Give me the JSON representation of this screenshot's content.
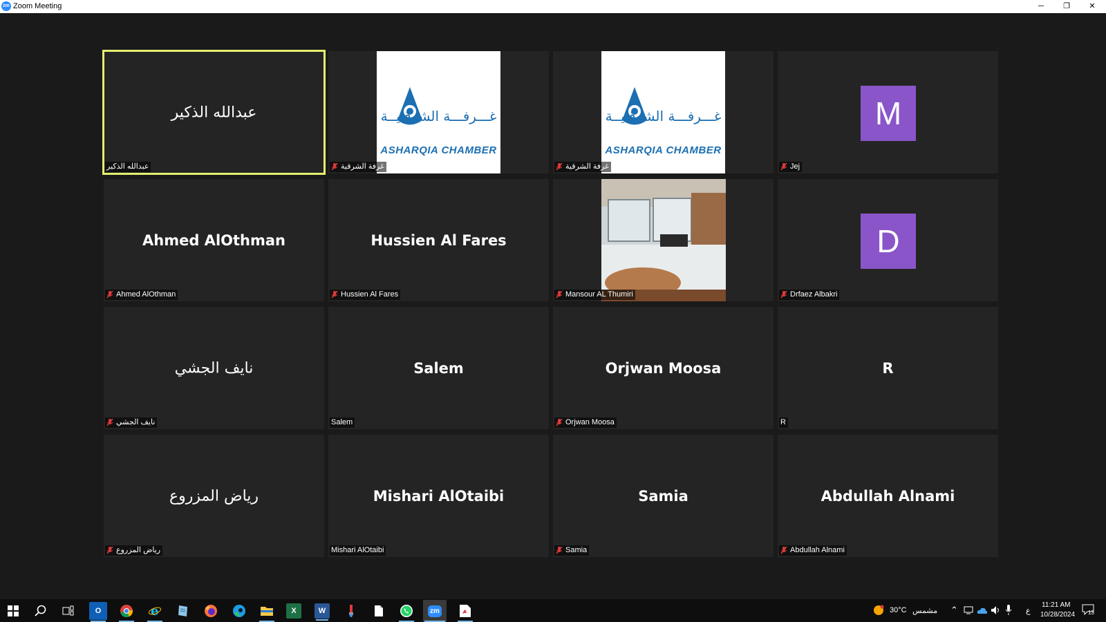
{
  "window": {
    "title": "Zoom Meeting",
    "app_icon": "zm"
  },
  "window_controls": {
    "minimize": "─",
    "restore": "❐",
    "close": "✕"
  },
  "tiles": [
    {
      "name": "عبدالله الذكير",
      "label": "عبدالله الذكير",
      "kind": "name",
      "rtl": true,
      "muted": false,
      "active": true
    },
    {
      "label": "غرفة الشرقية",
      "kind": "logo",
      "muted": true,
      "logo_ar": "غـــرفـــة الشرقـيــة",
      "logo_en": "ASHARQIA CHAMBER"
    },
    {
      "label": "غرفة الشرقية",
      "kind": "logo",
      "muted": true,
      "logo_ar": "غـــرفـــة الشرقـيــة",
      "logo_en": "ASHARQIA CHAMBER"
    },
    {
      "label": "Jej",
      "kind": "avatar",
      "initial": "M",
      "muted": true
    },
    {
      "name": "Ahmed AlOthman",
      "label": "Ahmed AlOthman",
      "kind": "name",
      "muted": true
    },
    {
      "name": "Hussien Al Fares",
      "label": "Hussien Al Fares",
      "kind": "name",
      "muted": true
    },
    {
      "label": "Mansour AL Thumiri",
      "kind": "photo",
      "muted": true
    },
    {
      "label": "Drfaez Albakri",
      "kind": "avatar",
      "initial": "D",
      "muted": true
    },
    {
      "name": "نايف الجشي",
      "label": "نايف الجشي",
      "kind": "name",
      "rtl": true,
      "muted": true
    },
    {
      "name": "Salem",
      "label": "Salem",
      "kind": "name",
      "muted": false
    },
    {
      "name": "Orjwan Moosa",
      "label": "Orjwan Moosa",
      "kind": "name",
      "muted": true
    },
    {
      "name": "R",
      "label": "R",
      "kind": "name",
      "muted": false
    },
    {
      "name": "رياض المزروع",
      "label": "رياض المزروع",
      "kind": "name",
      "rtl": true,
      "muted": true
    },
    {
      "name": "Mishari AlOtaibi",
      "label": "Mishari AlOtaibi",
      "kind": "name",
      "muted": false
    },
    {
      "name": "Samia",
      "label": "Samia",
      "kind": "name",
      "muted": true
    },
    {
      "name": "Abdullah Alnami",
      "label": "Abdullah Alnami",
      "kind": "name",
      "muted": true
    }
  ],
  "taskbar": {
    "apps": [
      "start",
      "search",
      "task-view",
      "outlook",
      "chrome",
      "internet-explorer",
      "notepad",
      "firefox",
      "edge",
      "file-explorer",
      "excel",
      "word",
      "paint",
      "file",
      "whatsapp",
      "zoom",
      "acrobat"
    ],
    "outlook_letter": "O",
    "excel_letter": "X",
    "word_letter": "W",
    "zoom_letter": "zm",
    "weather_temp": "30°C",
    "weather_text": "مشمس",
    "lang": "ع",
    "time": "11:21 AM",
    "date": "10/28/2024",
    "notifications": "13"
  },
  "colors": {
    "accent_active": "#e6ef6f",
    "avatar_purple": "#8a55c9",
    "mute_red": "#e03a3a",
    "zoom_blue": "#2d8cff"
  }
}
